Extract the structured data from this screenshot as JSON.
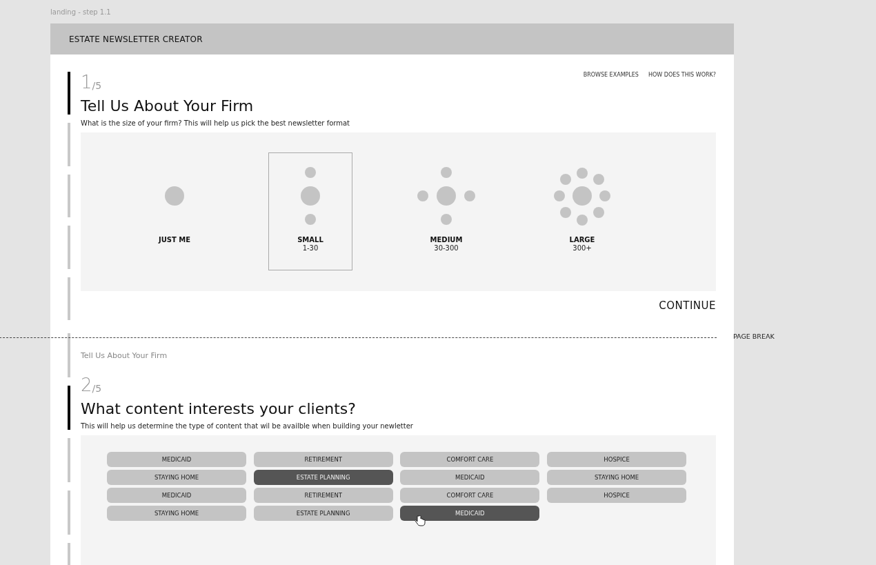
{
  "canvas_label": "landing - step 1.1",
  "header": {
    "title": "ESTATE NEWSLETTER CREATOR"
  },
  "top_links": [
    "BROWSE EXAMPLES",
    "HOW DOES THIS WORK?"
  ],
  "step1": {
    "number": "1",
    "total": "/5",
    "title": "Tell Us About Your Firm",
    "subtitle": "What is the size of your firm? This will help us pick the best newsletter format",
    "progress": [
      {
        "active": true
      },
      {
        "active": false
      },
      {
        "active": false
      },
      {
        "active": false
      },
      {
        "active": false
      }
    ],
    "options": [
      {
        "kind": "single",
        "label": "JUST ME",
        "selected": false
      },
      {
        "kind": "vertical",
        "label": "SMALL",
        "range": "1-30",
        "selected": true
      },
      {
        "kind": "cross",
        "label": "MEDIUM",
        "range": "30-300",
        "selected": false
      },
      {
        "kind": "ring",
        "label": "LARGE",
        "range": "300+",
        "selected": false
      }
    ],
    "continue": "CONTINUE"
  },
  "page_break": "PAGE BREAK",
  "step2": {
    "previous": "Tell Us About Your Firm",
    "number": "2",
    "total": "/5",
    "title": "What content interests your clients?",
    "subtitle": "This will help us determine the type of content that wil be availble when building your newletter",
    "progress": [
      {
        "active": false
      },
      {
        "active": true
      },
      {
        "active": false
      },
      {
        "active": false
      },
      {
        "active": false
      }
    ],
    "topics": [
      {
        "label": "MEDICAID",
        "selected": false
      },
      {
        "label": "RETIREMENT",
        "selected": false
      },
      {
        "label": "COMFORT CARE",
        "selected": false
      },
      {
        "label": "HOSPICE",
        "selected": false
      },
      {
        "label": "STAYING HOME",
        "selected": false
      },
      {
        "label": "ESTATE PLANNING",
        "selected": true
      },
      {
        "label": "MEDICAID",
        "selected": false
      },
      {
        "label": "STAYING HOME",
        "selected": false
      },
      {
        "label": "MEDICAID",
        "selected": false
      },
      {
        "label": "RETIREMENT",
        "selected": false
      },
      {
        "label": "COMFORT CARE",
        "selected": false
      },
      {
        "label": "HOSPICE",
        "selected": false
      },
      {
        "label": "STAYING HOME",
        "selected": false
      },
      {
        "label": "ESTATE PLANNING",
        "selected": false
      },
      {
        "label": "MEDICAID",
        "selected": true,
        "hovered": true
      }
    ]
  }
}
